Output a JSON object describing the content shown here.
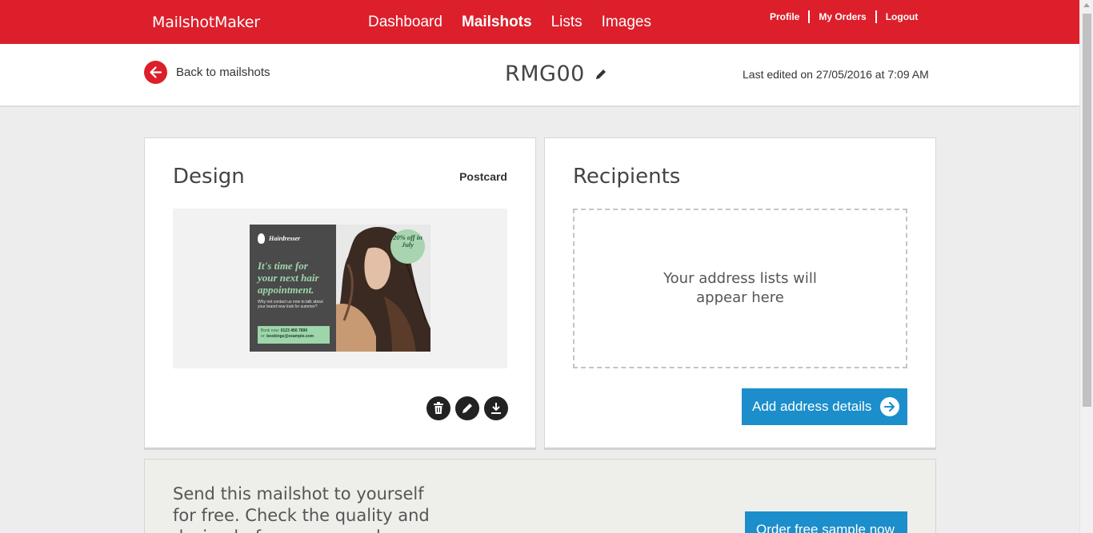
{
  "brand": "MailshotMaker",
  "nav": {
    "items": [
      {
        "label": "Dashboard",
        "active": false
      },
      {
        "label": "Mailshots",
        "active": true
      },
      {
        "label": "Lists",
        "active": false
      },
      {
        "label": "Images",
        "active": false
      }
    ],
    "user_links": [
      "Profile",
      "My Orders",
      "Logout"
    ]
  },
  "subheader": {
    "back_label": "Back to mailshots",
    "title": "RMG00",
    "last_edited": "Last edited on 27/05/2016 at 7:09 AM"
  },
  "design": {
    "heading": "Design",
    "format": "Postcard",
    "postcard": {
      "brand": "Hairdresser",
      "headline": "It's time for your next hair appointment.",
      "body": "Why not contact us now to talk about your brand new look for summer?",
      "contact_line1_label": "Book now:",
      "contact_line1_value": "0123 456 7890",
      "contact_line2_label": "or:",
      "contact_line2_value": "bookings@example.com",
      "badge": "20% off in July"
    },
    "actions": [
      "trash-icon",
      "pencil-icon",
      "download-icon"
    ]
  },
  "recipients": {
    "heading": "Recipients",
    "placeholder": "Your address lists will appear here",
    "button_label": "Add address details"
  },
  "sample": {
    "text": "Send this mailshot to yourself for free. Check the quality and design before you spend",
    "button_label": "Order free sample now"
  },
  "colors": {
    "brand_red": "#dc1f2b",
    "action_blue": "#1b8ecb",
    "mint": "#9ed6ac"
  }
}
